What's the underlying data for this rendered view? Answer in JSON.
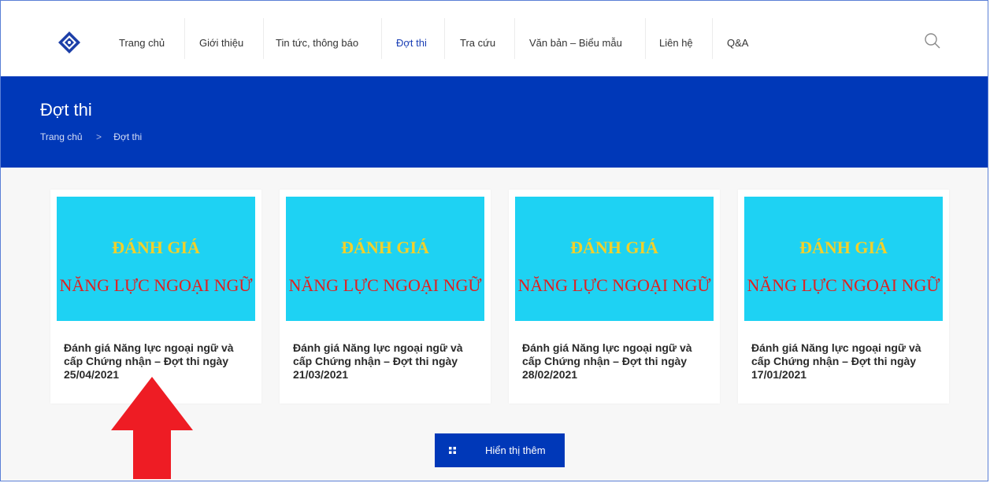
{
  "nav": {
    "items": [
      {
        "label": "Trang chủ",
        "active": false
      },
      {
        "label": "Giới thiệu",
        "active": false
      },
      {
        "label": "Tin tức, thông báo",
        "active": false
      },
      {
        "label": "Đợt thi",
        "active": true
      },
      {
        "label": "Tra cứu",
        "active": false
      },
      {
        "label": "Văn bản – Biểu mẫu",
        "active": false
      },
      {
        "label": "Liên hệ",
        "active": false
      },
      {
        "label": "Q&A",
        "active": false
      }
    ],
    "search_icon": "search-icon"
  },
  "banner": {
    "title": "Đợt thi",
    "breadcrumb": {
      "home": "Trang chủ",
      "separator": ">",
      "current": "Đợt thi"
    }
  },
  "cards": [
    {
      "thumb_line1": "ĐÁNH GIÁ",
      "thumb_line2": "NĂNG LỰC NGOẠI NGỮ",
      "title": "Đánh giá Năng lực ngoại ngữ và cấp Chứng nhận – Đợt thi ngày 25/04/2021"
    },
    {
      "thumb_line1": "ĐÁNH GIÁ",
      "thumb_line2": "NĂNG LỰC NGOẠI NGỮ",
      "title": "Đánh giá Năng lực ngoại ngữ và cấp Chứng nhận – Đợt thi ngày 21/03/2021"
    },
    {
      "thumb_line1": "ĐÁNH GIÁ",
      "thumb_line2": "NĂNG LỰC NGOẠI NGỮ",
      "title": "Đánh giá Năng lực ngoại ngữ và cấp Chứng nhận – Đợt thi ngày 28/02/2021"
    },
    {
      "thumb_line1": "ĐÁNH GIÁ",
      "thumb_line2": "NĂNG LỰC NGOẠI NGỮ",
      "title": "Đánh giá Năng lực ngoại ngữ và cấp Chứng nhận – Đợt thi ngày 17/01/2021"
    }
  ],
  "load_more": {
    "label": "Hiển thị thêm",
    "icon": "grid-icon"
  },
  "colors": {
    "brand_blue": "#0038b8",
    "active_nav": "#1a3fb5",
    "thumb_bg": "#1ed2f3",
    "arrow_red": "#ee1c24"
  }
}
